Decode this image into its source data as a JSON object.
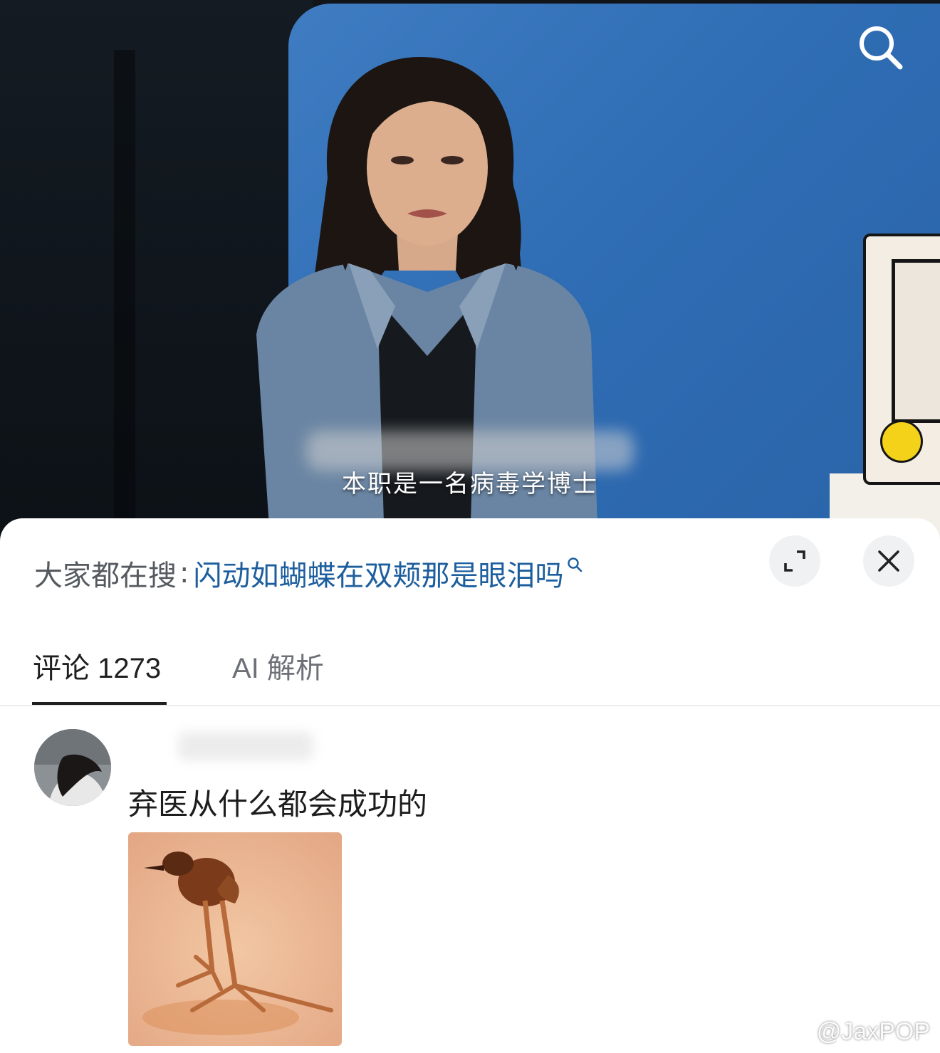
{
  "video": {
    "subtitle": "本职是一名病毒学博士"
  },
  "trending": {
    "label": "大家都在搜",
    "colon": ":",
    "query": "闪动如蝴蝶在双颊那是眼泪吗"
  },
  "tabs": [
    {
      "label": "评论 1273",
      "active": true
    },
    {
      "label": "AI 解析",
      "active": false
    }
  ],
  "comment": {
    "text": "弃医从什么都会成功的"
  },
  "watermark": {
    "handle": "@JaxPOP"
  },
  "icons": {
    "search": "search-icon",
    "expand": "expand-icon",
    "close": "close-icon",
    "weibo": "weibo-logo-icon"
  },
  "colors": {
    "accent_link": "#1d5e9e",
    "tab_active": "#1f1f1f",
    "tab_inactive": "#6d7177"
  }
}
